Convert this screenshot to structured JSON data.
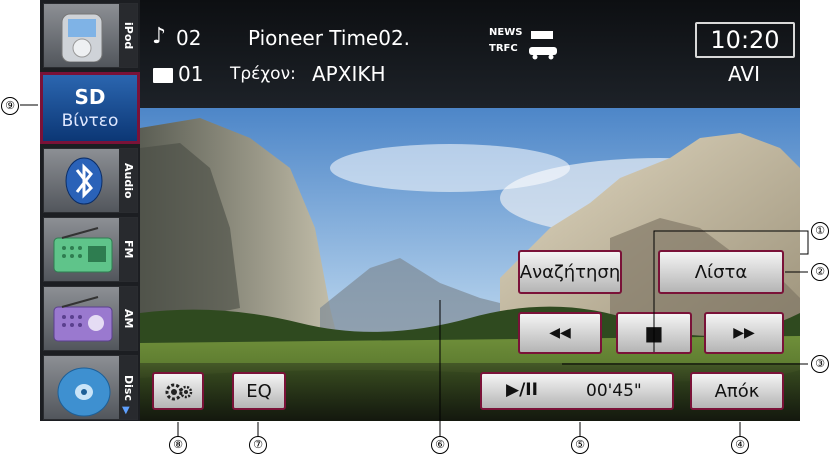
{
  "header": {
    "track_number": "02",
    "track_title": "Pioneer Time02.",
    "folder_number": "01",
    "status_label": "Τρέχον:",
    "status_value": "ΑΡΧΙΚΗ",
    "news_label": "NEWS",
    "trfc_label": "TRFC",
    "clock": "10:20",
    "file_format": "AVI"
  },
  "sidebar": {
    "items": [
      {
        "label": "iPod",
        "icon": "ipod-icon"
      },
      {
        "label": "SD",
        "sub_label": "Βίντεο",
        "icon": "sd-video-icon"
      },
      {
        "label": "Audio",
        "icon": "bluetooth-icon"
      },
      {
        "label": "FM",
        "icon": "radio-icon"
      },
      {
        "label": "AM",
        "icon": "radio-icon"
      },
      {
        "label": "Disc",
        "icon": "disc-icon"
      }
    ]
  },
  "controls": {
    "search_label": "Αναζήτηση",
    "list_label": "Λίστα",
    "prev_label": "◀◀",
    "stop_label": "■",
    "next_label": "▶▶",
    "play_pause_label": "▶/II",
    "elapsed_time": "00'45\"",
    "hide_label": "Απόκ",
    "eq_label": "EQ"
  },
  "callouts": {
    "c1": "①",
    "c2": "②",
    "c3": "③",
    "c4": "④",
    "c5": "⑤",
    "c6": "⑥",
    "c7": "⑦",
    "c8": "⑧",
    "c9": "⑨"
  },
  "colors": {
    "button_border": "#7a1238",
    "selected_source": "#1a4c8c",
    "sky": "#8fb9e0"
  }
}
